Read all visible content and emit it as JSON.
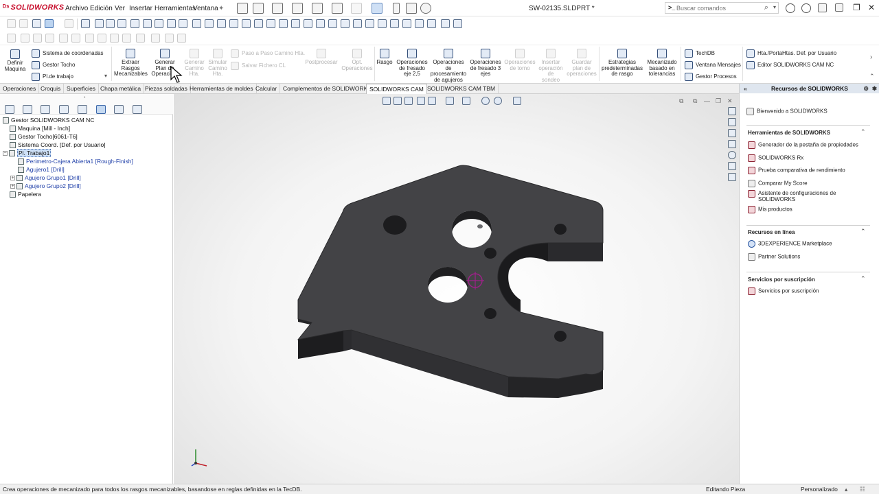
{
  "app": {
    "name": "SOLIDWORKS",
    "document_title": "SW-02135.SLDPRT *"
  },
  "menu": [
    "Archivo",
    "Edición",
    "Ver",
    "Insertar",
    "Herramientas",
    "Ventana"
  ],
  "search": {
    "placeholder": "Buscar comandos"
  },
  "ribbon": {
    "definir_maquina": "Definir\nMaquina",
    "sistema_coordenadas": "Sistema de coordenadas",
    "gestor_tocho": "Gestor Tocho",
    "pl_trabajo": "Pl.de trabajo",
    "extraer_rasgos": "Extraer\nRasgos\nMecanizables",
    "generar_plan": "Generar\nPlan de\nOperacio...",
    "generar_camino": "Generar\nCamino\nHta.",
    "simular_camino": "Simular\nCamino\nHta.",
    "paso_a_paso": "Paso a Paso Camino Hta.",
    "salvar_fichero": "Salvar Fichero CL",
    "postprocesar": "Postprocesar",
    "opt_operaciones": "Opt.\nOperaciones",
    "rasgo": "Rasgo",
    "op_fresado_25": "Operaciones\nde fresado\neje 2,5",
    "op_agujeros": "Operaciones\nde\nprocesamiento\nde agujeros",
    "op_fresado_3": "Operaciones\nde fresado 3\nejes",
    "op_torno": "Operaciones\nde torno",
    "insertar_operacion": "Insertar\noperación\nde\nsondeo",
    "guardar_plan": "Guardar\nplan de\noperaciones",
    "estrategias": "Estrategias\npredeterminadas\nde rasgo",
    "mecanizado_tolerancias": "Mecanizado\nbasado en\ntolerancias",
    "techdb": "TechDB",
    "ventana_mensajes": "Ventana Mensajes",
    "gestor_procesos": "Gestor Procesos",
    "hta_portahtas": "Hta./PortaHtas. Def. por Usuario",
    "editor_cam": "Editor SOLIDWORKS CAM NC"
  },
  "tabs": [
    "Operaciones",
    "Croquis",
    "Superficies",
    "Chapa metálica",
    "Piezas soldadas",
    "Herramientas de moldes",
    "Calcular",
    "Complementos de SOLIDWORKS",
    "SOLIDWORKS CAM",
    "SOLIDWORKS CAM TBM"
  ],
  "active_tab": "SOLIDWORKS CAM",
  "tree": {
    "root": "Gestor SOLIDWORKS CAM NC",
    "items": [
      "Maquina [Mill - Inch]",
      "Gestor Tocho[6061-T6]",
      "Sistema Coord. [Def. por Usuario]",
      "Pl. Trabajo1",
      "Perimetro-Cajera Abierta1 [Rough-Finish]",
      "Agujero1 [Drill]",
      "Agujero Grupo1 [Drill]",
      "Agujero Grupo2 [Drill]",
      "Papelera"
    ]
  },
  "taskpane": {
    "title": "Recursos de SOLIDWORKS",
    "welcome": "Bienvenido a SOLIDWORKS",
    "section_tools": "Herramientas de SOLIDWORKS",
    "tools": [
      "Generador de la pestaña de propiedades",
      "SOLIDWORKS Rx",
      "Prueba comparativa de rendimiento",
      "Comparar My Score",
      "Asistente de configuraciones de\nSOLIDWORKS",
      "Mis productos"
    ],
    "section_online": "Recursos en línea",
    "online": [
      "3DEXPERIENCE Marketplace",
      "Partner Solutions"
    ],
    "section_subscription": "Servicios por suscripción",
    "subscription": [
      "Servicios por suscripción"
    ]
  },
  "status": {
    "message": "Crea operaciones de mecanizado para todos los rasgos mecanizables, basandose en reglas definidas en la TecDB.",
    "mode": "Editando Pieza",
    "units": "Personalizado"
  },
  "colors": {
    "accent": "#c8102e",
    "part": "#3f3f42",
    "selection": "#cde0f7"
  }
}
